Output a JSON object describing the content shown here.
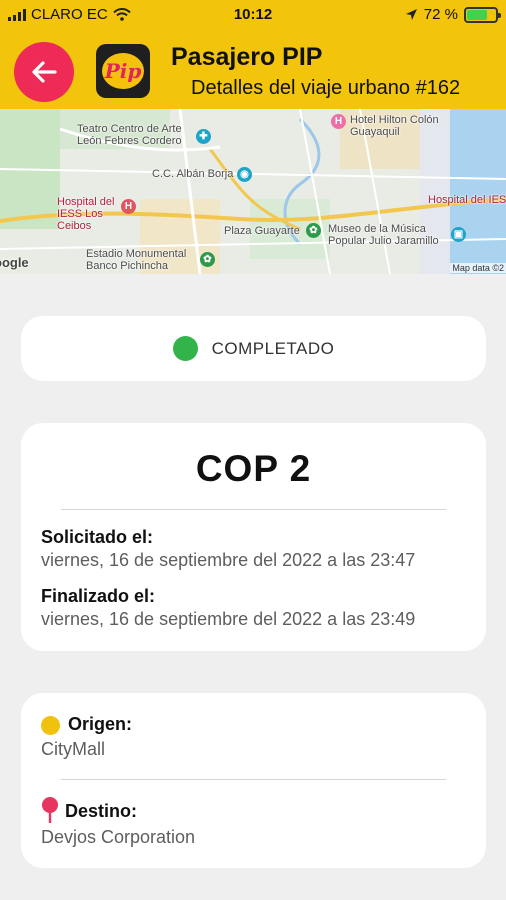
{
  "status_bar": {
    "carrier": "CLARO EC",
    "time": "10:12",
    "battery": "72 %",
    "battery_level": 0.72
  },
  "header": {
    "title": "Pasajero PIP",
    "subtitle": "Detalles del viaje urbano #162",
    "logo_text": "Pip"
  },
  "map": {
    "labels": {
      "teatro": "Teatro Centro de Arte León Febres Cordero",
      "hilton": "Hotel Hilton Colón Guayaquil",
      "alban": "C.C. Albán Borja",
      "hospital_ceibos": "Hospital del IESS Los Ceibos",
      "hospital_right": "Hospital del IES",
      "plaza": "Plaza Guayarte",
      "museo": "Museo de la Música Popular Julio Jaramillo",
      "estadio": "Estadio Monumental Banco Pichincha"
    },
    "google": "oogle",
    "map_data": "Map data ©2"
  },
  "trip": {
    "status": "COMPLETADO",
    "fare": "COP 2",
    "requested_label": "Solicitado el:",
    "requested_value": "viernes, 16 de septiembre del 2022 a las 23:47",
    "finished_label": "Finalizado el:",
    "finished_value": "viernes, 16 de septiembre del 2022 a las 23:49"
  },
  "route": {
    "origin_label": "Origen:",
    "origin_value": "CityMall",
    "destination_label": "Destino:",
    "destination_value": "Devjos Corporation"
  },
  "colors": {
    "header_bg": "#f2c40c",
    "back_button": "#ee2b56",
    "status_completed": "#33b44a",
    "origin_marker": "#f0c20e",
    "destination_marker": "#e8355f"
  }
}
